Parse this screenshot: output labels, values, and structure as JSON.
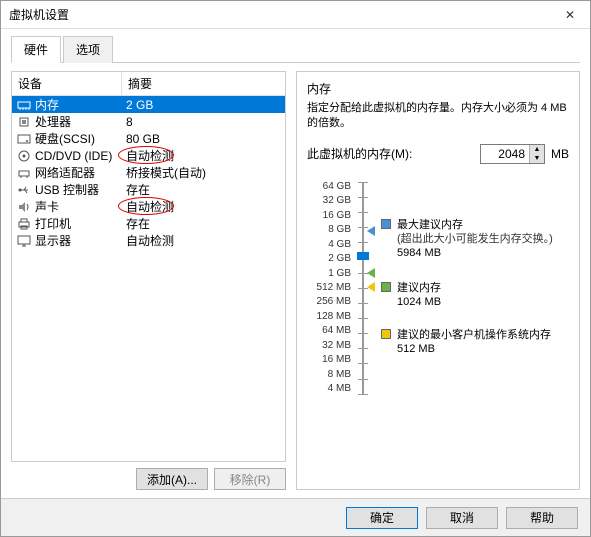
{
  "window": {
    "title": "虚拟机设置"
  },
  "tabs": {
    "hardware": "硬件",
    "options": "选项"
  },
  "hw_header": {
    "device": "设备",
    "summary": "摘要"
  },
  "devices": [
    {
      "name": "内存",
      "summary": "2 GB",
      "icon": "memory",
      "selected": true
    },
    {
      "name": "处理器",
      "summary": "8",
      "icon": "cpu"
    },
    {
      "name": "硬盘(SCSI)",
      "summary": "80 GB",
      "icon": "disk"
    },
    {
      "name": "CD/DVD (IDE)",
      "summary": "自动检测",
      "icon": "cd",
      "circled": true
    },
    {
      "name": "网络适配器",
      "summary": "桥接模式(自动)",
      "icon": "net"
    },
    {
      "name": "USB 控制器",
      "summary": "存在",
      "icon": "usb"
    },
    {
      "name": "声卡",
      "summary": "自动检测",
      "icon": "sound",
      "circled": true
    },
    {
      "name": "打印机",
      "summary": "存在",
      "icon": "printer"
    },
    {
      "name": "显示器",
      "summary": "自动检测",
      "icon": "display"
    }
  ],
  "left_buttons": {
    "add": "添加(A)...",
    "remove": "移除(R)"
  },
  "right": {
    "title": "内存",
    "desc": "指定分配给此虚拟机的内存量。内存大小必须为 4 MB 的倍数。",
    "label": "此虚拟机的内存(M):",
    "value": "2048",
    "unit": "MB",
    "ticks": [
      "64 GB",
      "32 GB",
      "16 GB",
      "8 GB",
      "4 GB",
      "2 GB",
      "1 GB",
      "512 MB",
      "256 MB",
      "128 MB",
      "64 MB",
      "32 MB",
      "16 MB",
      "8 MB",
      "4 MB"
    ],
    "legend": {
      "max": {
        "title": "最大建议内存",
        "sub": "(超出此大小可能发生内存交换。)",
        "val": "5984 MB"
      },
      "rec": {
        "title": "建议内存",
        "val": "1024 MB"
      },
      "min": {
        "title": "建议的最小客户机操作系统内存",
        "val": "512 MB"
      }
    }
  },
  "footer": {
    "ok": "确定",
    "cancel": "取消",
    "help": "帮助"
  }
}
